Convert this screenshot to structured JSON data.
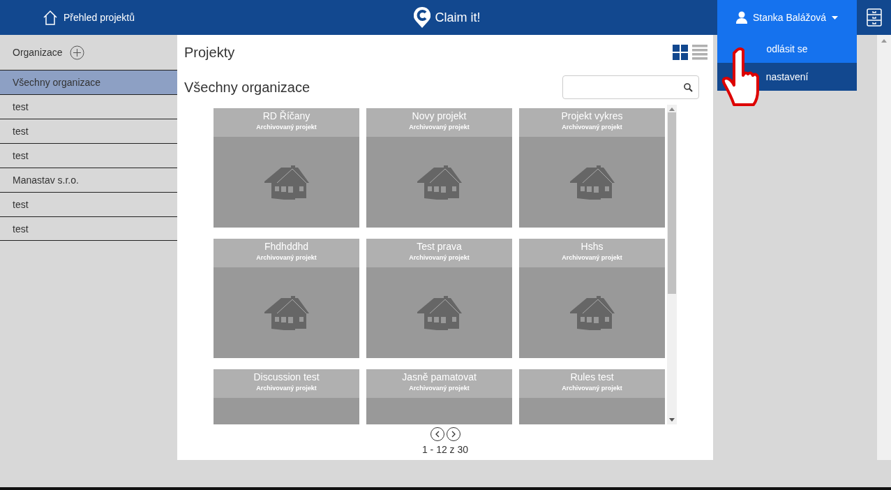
{
  "header": {
    "nav_link": "Přehled projektů",
    "logo_text": "Claim it!",
    "user_name": "Stanka Balážová"
  },
  "user_menu": [
    {
      "label": "odlásit se",
      "selected": true
    },
    {
      "label": "nastavení",
      "selected": false
    }
  ],
  "sidebar": {
    "title": "Organizace",
    "items": [
      {
        "label": "Všechny organizace",
        "selected": true
      },
      {
        "label": "test",
        "selected": false
      },
      {
        "label": "test",
        "selected": false
      },
      {
        "label": "test",
        "selected": false
      },
      {
        "label": "Manastav s.r.o.",
        "selected": false
      },
      {
        "label": "test",
        "selected": false
      },
      {
        "label": "test",
        "selected": false
      }
    ]
  },
  "main": {
    "title": "Projekty",
    "subtitle": "Všechny organizace",
    "view_modes": [
      {
        "kind": "grid",
        "selected": true
      },
      {
        "kind": "list",
        "selected": false
      }
    ],
    "projects": [
      {
        "name": "RD Říčany",
        "status": "Archivovaný projekt"
      },
      {
        "name": "Novy projekt",
        "status": "Archivovaný projekt"
      },
      {
        "name": "Projekt vykres",
        "status": "Archivovaný projekt"
      },
      {
        "name": "Fhdhddhd",
        "status": "Archivovaný projekt"
      },
      {
        "name": "Test prava",
        "status": "Archivovaný projekt"
      },
      {
        "name": "Hshs",
        "status": "Archivovaný projekt"
      },
      {
        "name": "Discussion test",
        "status": "Archivovaný projekt"
      },
      {
        "name": "Jasně pamatovat",
        "status": "Archivovaný projekt"
      },
      {
        "name": "Rules test",
        "status": "Archivovaný projekt"
      }
    ],
    "pagination": "1 - 12 z 30"
  }
}
